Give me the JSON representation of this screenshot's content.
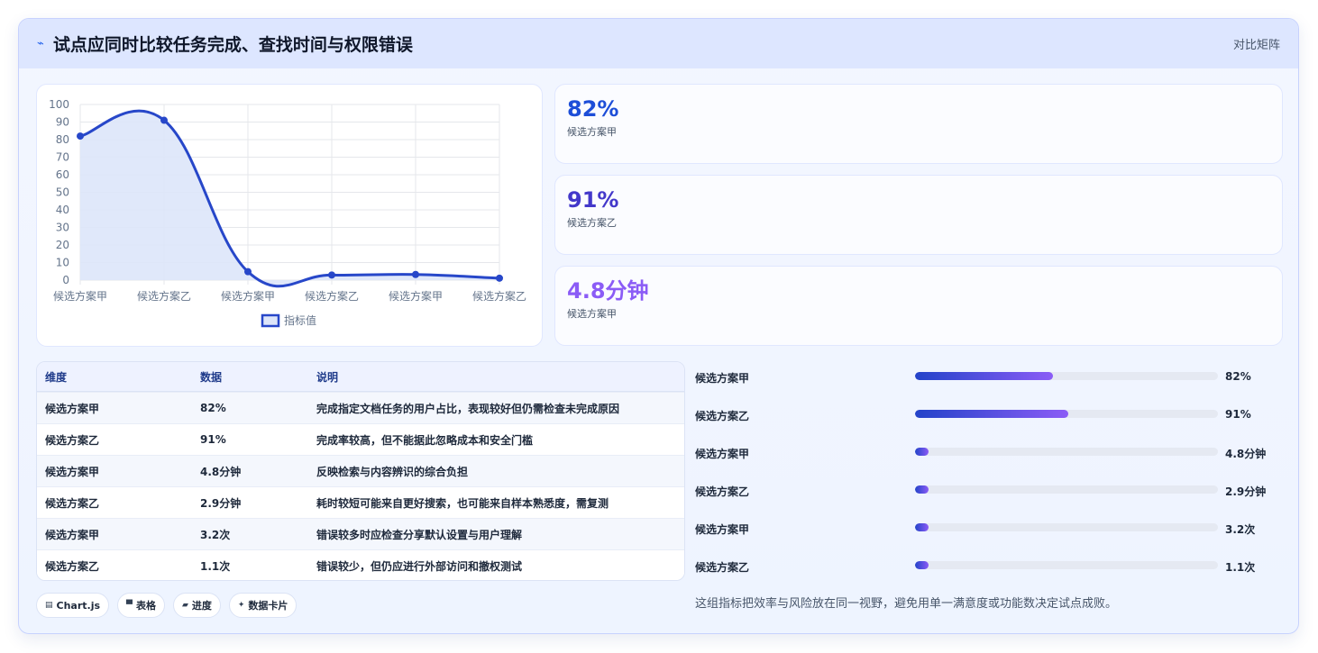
{
  "header": {
    "icon": "trend-icon",
    "title": "试点应同时比较任务完成、查找时间与权限错误",
    "right_label": "对比矩阵"
  },
  "chart_data": {
    "type": "line",
    "categories": [
      "候选方案甲",
      "候选方案乙",
      "候选方案甲",
      "候选方案乙",
      "候选方案甲",
      "候选方案乙"
    ],
    "series": [
      {
        "name": "指标值",
        "values": [
          82,
          91,
          4.8,
          2.9,
          3.2,
          1.1
        ]
      }
    ],
    "ylim": [
      0,
      100
    ],
    "yticks": [
      "100",
      "90",
      "80",
      "70",
      "60",
      "50",
      "40",
      "30",
      "20",
      "10",
      "0"
    ],
    "area_fill": true,
    "grid": true,
    "legend": "bottom",
    "colors": {
      "line": "#2747c9",
      "fill": "#dde5f9"
    }
  },
  "stats": [
    {
      "value": "82%",
      "label": "候选方案甲",
      "color": "#1d4ed8"
    },
    {
      "value": "91%",
      "label": "候选方案乙",
      "color": "#4338ca"
    },
    {
      "value": "4.8分钟",
      "label": "候选方案甲",
      "color": "#8b5cf6"
    }
  ],
  "table": {
    "headers": [
      "维度",
      "数据",
      "说明"
    ],
    "rows": [
      [
        "候选方案甲",
        "82%",
        "完成指定文档任务的用户占比，表现较好但仍需检查未完成原因"
      ],
      [
        "候选方案乙",
        "91%",
        "完成率较高，但不能据此忽略成本和安全门槛"
      ],
      [
        "候选方案甲",
        "4.8分钟",
        "反映检索与内容辨识的综合负担"
      ],
      [
        "候选方案乙",
        "2.9分钟",
        "耗时较短可能来自更好搜索，也可能来自样本熟悉度，需复测"
      ],
      [
        "候选方案甲",
        "3.2次",
        "错误较多时应检查分享默认设置与用户理解"
      ],
      [
        "候选方案乙",
        "1.1次",
        "错误较少，但仍应进行外部访问和撤权测试"
      ]
    ]
  },
  "chips": [
    {
      "icon": "chart-icon",
      "glyph": "▤",
      "label": "Chart.js"
    },
    {
      "icon": "table-icon",
      "glyph": "▀",
      "label": "表格"
    },
    {
      "icon": "progress-icon",
      "glyph": "▰",
      "label": "进度"
    },
    {
      "icon": "sparkle-icon",
      "glyph": "✦",
      "label": "数据卡片"
    }
  ],
  "progress": [
    {
      "label": "候选方案甲",
      "value": "82%",
      "fraction": 0.455
    },
    {
      "label": "候选方案乙",
      "value": "91%",
      "fraction": 0.505
    },
    {
      "label": "候选方案甲",
      "value": "4.8分钟",
      "fraction": 0.045
    },
    {
      "label": "候选方案乙",
      "value": "2.9分钟",
      "fraction": 0.045
    },
    {
      "label": "候选方案甲",
      "value": "3.2次",
      "fraction": 0.045
    },
    {
      "label": "候选方案乙",
      "value": "1.1次",
      "fraction": 0.045
    }
  ],
  "footnote": "这组指标把效率与风险放在同一视野，避免用单一满意度或功能数决定试点成败。"
}
